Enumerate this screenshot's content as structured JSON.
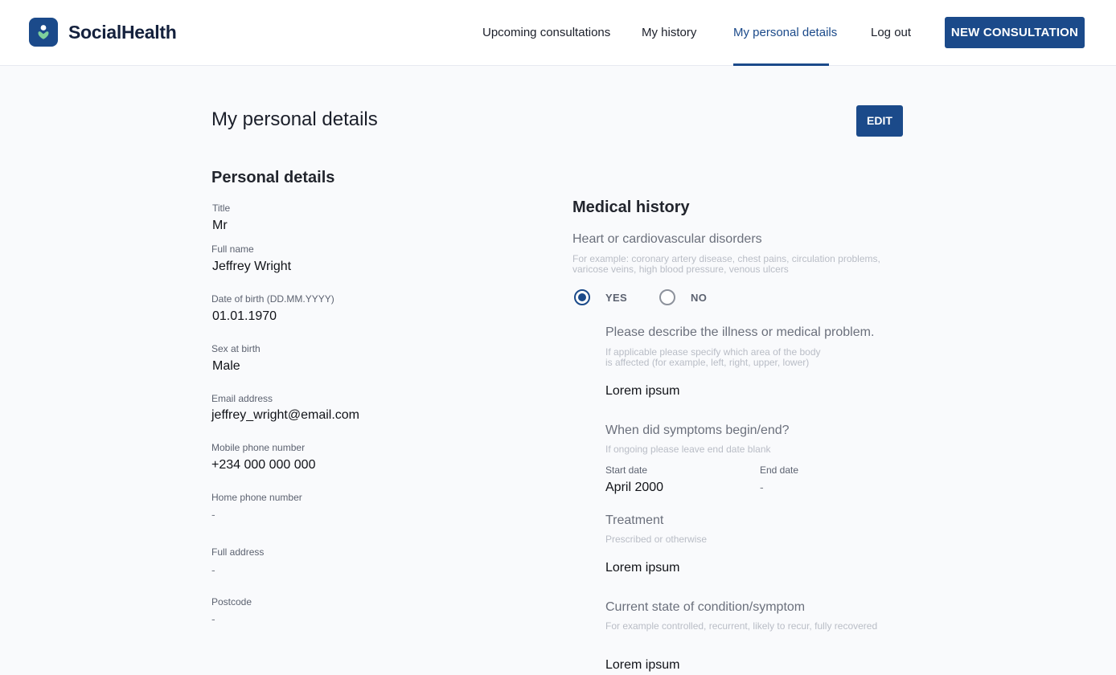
{
  "header": {
    "brand": "SocialHealth",
    "nav": [
      {
        "label": "Upcoming consultations"
      },
      {
        "label": "My history"
      },
      {
        "label": "My personal details"
      },
      {
        "label": "Log out"
      }
    ],
    "new_consultation_label": "NEW CONSULTATION",
    "accent_color": "#1b4a8a"
  },
  "page": {
    "title": "My personal details",
    "edit_label": "EDIT"
  },
  "personal": {
    "section_title": "Personal details",
    "fields": [
      {
        "label": "Title",
        "value": "Mr"
      },
      {
        "label": "Full name",
        "value": "Jeffrey Wright"
      },
      {
        "label": "Date of birth (DD.MM.YYYY)",
        "value": "01.01.1970"
      },
      {
        "label": "Sex at birth",
        "value": "Male"
      },
      {
        "label": "Email address",
        "value": "jeffrey_wright@email.com"
      },
      {
        "label": "Mobile phone number",
        "value": "+234 000 000 000"
      },
      {
        "label": "Home phone number",
        "value": "-"
      },
      {
        "label": "Full address",
        "value": "-"
      },
      {
        "label": "Postcode",
        "value": "-"
      }
    ]
  },
  "medical": {
    "section_title": "Medical history",
    "question": "Heart or cardiovascular disorders",
    "question_hint_line1": "For example: coronary artery disease, chest pains, circulation problems,",
    "question_hint_line2": "varicose veins, high blood pressure, venous ulcers",
    "options": {
      "yes": "YES",
      "no": "NO",
      "selected": "YES"
    },
    "describe_title": "Please describe the illness or medical problem.",
    "describe_hint_line1": "If applicable please specify which area of the body",
    "describe_hint_line2": "is affected (for example, left, right, upper, lower)",
    "describe_value": "Lorem ipsum",
    "symptoms_title": "When did symptoms begin/end?",
    "symptoms_hint": "If ongoing please leave end date blank",
    "start_label": "Start date",
    "start_value": "April 2000",
    "end_label": "End date",
    "end_value": "-",
    "treatment_title": "Treatment",
    "treatment_hint": "Prescribed or otherwise",
    "treatment_value": "Lorem ipsum",
    "state_title": "Current state of condition/symptom",
    "state_hint": "For example controlled, recurrent, likely to recur, fully recovered",
    "state_value": "Lorem ipsum"
  }
}
